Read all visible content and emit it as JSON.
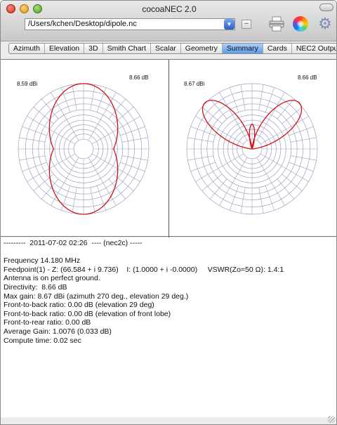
{
  "window": {
    "title": "cocoaNEC 2.0"
  },
  "toolbar": {
    "file_path": "/Users/kchen/Desktop/dipole.nc",
    "minus_label": "–"
  },
  "tabs": [
    {
      "label": "Azimuth"
    },
    {
      "label": "Elevation"
    },
    {
      "label": "3D"
    },
    {
      "label": "Smith Chart"
    },
    {
      "label": "Scalar"
    },
    {
      "label": "Geometry"
    },
    {
      "label": "Summary",
      "active": true
    },
    {
      "label": "Cards"
    },
    {
      "label": "NEC2 Output"
    }
  ],
  "plots": {
    "azimuth": {
      "max_label": "8.59 dBi",
      "ref_label": "8.66 dB"
    },
    "elevation": {
      "max_label": "8.67 dBi",
      "ref_label": "8.66 dB"
    }
  },
  "summary": {
    "lines": [
      "---------  2011-07-02 02:26  ---- (nec2c) -----",
      "",
      "Frequency 14.180 MHz",
      "Feedpoint(1) - Z: (66.584 + i 9.736)    I: (1.0000 + i -0.0000)     VSWR(Zo=50 Ω): 1.4:1",
      "Antenna is on perfect ground.",
      "Directivity:  8.66 dB",
      "Max gain: 8.67 dBi (azimuth 270 deg., elevation 29 deg.)",
      "Front-to-back ratio: 0.00 dB (elevation 29 deg)",
      "Front-to-back ratio: 0.00 dB (elevation of front lobe)",
      "Front-to-rear ratio: 0.00 dB",
      "Average Gain: 1.0076 (0.033 dB)",
      "Compute time: 0.02 sec"
    ]
  },
  "colors": {
    "pattern": "#d0121a",
    "grid": "#9aa0c4",
    "tab_active": "#7fb3ee"
  }
}
